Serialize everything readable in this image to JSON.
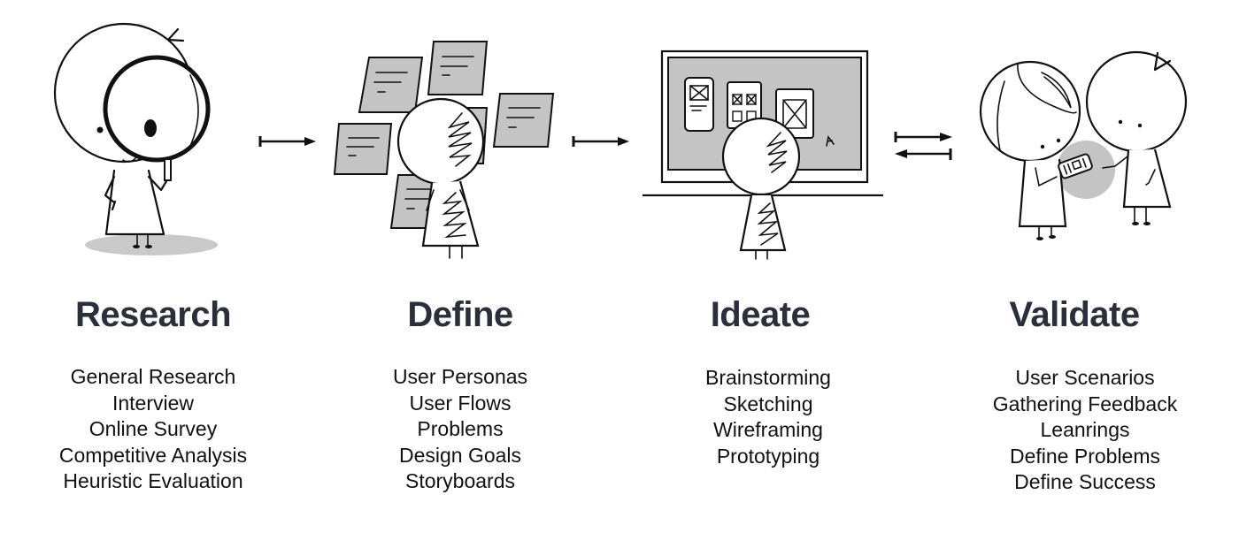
{
  "diagram": {
    "flow": "linear with iterative loop between Ideate and Validate",
    "stages": [
      {
        "title": "Research",
        "illustration": "character-with-magnifying-glass",
        "items": [
          "General Research",
          "Interview",
          "Online Survey",
          "Competitive Analysis",
          "Heuristic Evaluation"
        ]
      },
      {
        "title": "Define",
        "illustration": "character-with-sticky-notes",
        "items": [
          "User Personas",
          "User Flows",
          "Problems",
          "Design Goals",
          "Storyboards"
        ]
      },
      {
        "title": "Ideate",
        "illustration": "character-at-whiteboard-with-wireframes",
        "items": [
          "Brainstorming",
          "Sketching",
          "Wireframing",
          "Prototyping"
        ]
      },
      {
        "title": "Validate",
        "illustration": "two-characters-sharing-phone",
        "items": [
          "User Scenarios",
          "Gathering Feedback",
          "Leanrings",
          "Define Problems",
          "Define Success"
        ]
      }
    ],
    "connectors": [
      {
        "from": "Research",
        "to": "Define",
        "type": "arrow-right"
      },
      {
        "from": "Define",
        "to": "Ideate",
        "type": "arrow-right"
      },
      {
        "from": "Ideate",
        "to": "Validate",
        "type": "bidirectional-arrows"
      }
    ],
    "colors": {
      "title": "#2b2f3a",
      "text": "#111111",
      "shade": "#c4c4c4",
      "background": "#ffffff"
    }
  }
}
